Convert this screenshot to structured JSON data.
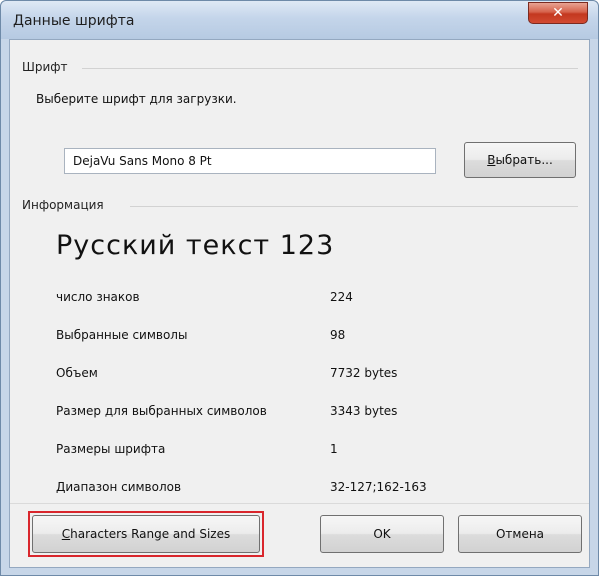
{
  "window": {
    "title": "Данные шрифта",
    "close_glyph": "✕"
  },
  "font_group": {
    "label": "Шрифт",
    "hint": "Выберите шрифт для загрузки.",
    "font_value": "DejaVu Sans Mono 8 Pt",
    "choose_button": {
      "mnemonic": "В",
      "rest": "ыбрать..."
    }
  },
  "info_group": {
    "label": "Информация",
    "sample_text": "Русский текст 123",
    "rows": [
      {
        "label": "число знаков",
        "value": "224"
      },
      {
        "label": "Выбранные символы",
        "value": "98"
      },
      {
        "label": "Объем",
        "value": "7732 bytes"
      },
      {
        "label": "Размер для выбранных символов",
        "value": "3343 bytes"
      },
      {
        "label": "Размеры шрифта",
        "value": "1"
      },
      {
        "label": "Диапазон символов",
        "value": "32-127;162-163"
      }
    ]
  },
  "buttons": {
    "ranges": {
      "mnemonic": "C",
      "rest": "haracters Range and Sizes"
    },
    "ok": "OK",
    "cancel": "Отмена"
  },
  "colors": {
    "highlight": "#d9262c",
    "close_button": "#c3381f"
  }
}
